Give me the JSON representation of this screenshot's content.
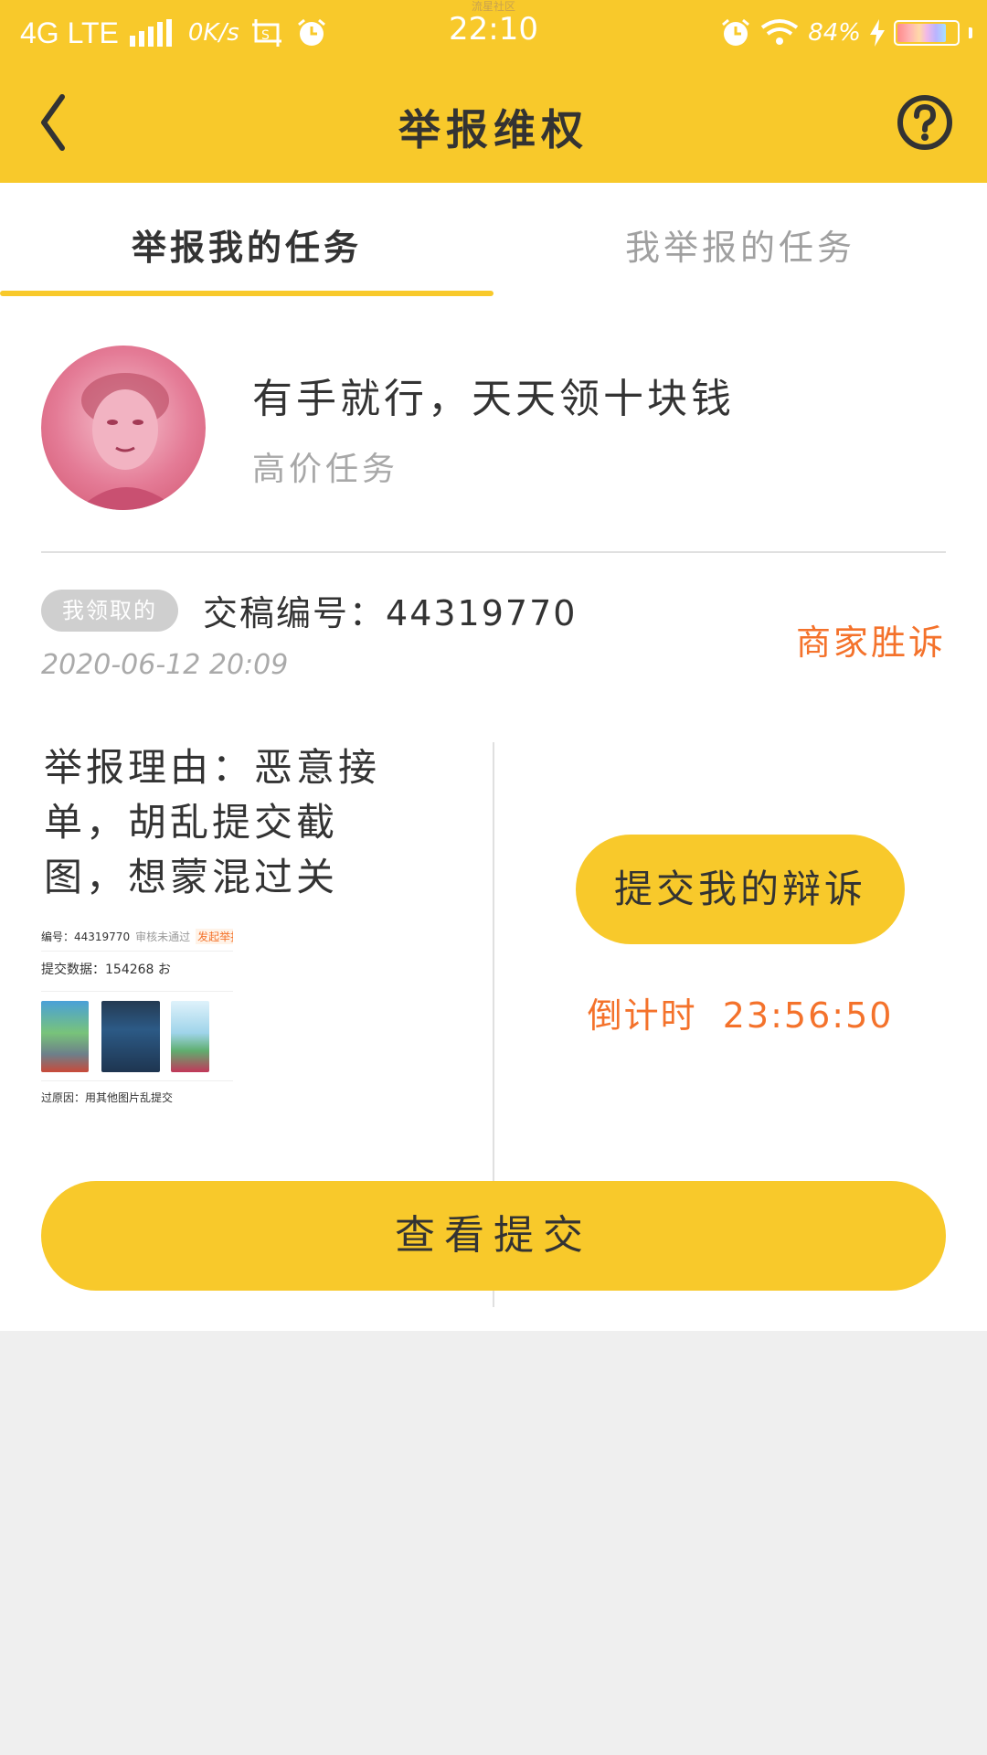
{
  "status_bar": {
    "network": "4G LTE",
    "speed": "0K/s",
    "carrier_sub": "流星社区",
    "time": "22:10",
    "battery": "84%",
    "battery_level": 0.84
  },
  "header": {
    "title": "举报维权",
    "back_icon": "chevron-left-icon",
    "help_icon": "question-circle-icon"
  },
  "tabs": [
    {
      "label": "举报我的任务",
      "active": true
    },
    {
      "label": "我举报的任务",
      "active": false
    }
  ],
  "task": {
    "title": "有手就行，天天领十块钱",
    "subtitle": "高价任务"
  },
  "record": {
    "badge": "我领取的",
    "submission_label": "交稿编号：",
    "submission_no": "44319770",
    "timestamp": "2020-06-12  20:09",
    "status": "商家胜诉",
    "reason_label": "举报理由：",
    "reason_text": "恶意接单，胡乱提交截图，想蒙混过关"
  },
  "thumbnail": {
    "row1_label": "编号：44319770",
    "row1_status": "审核未通过",
    "row1_tag": "发起举报",
    "row2": "提交数据：154268 お",
    "row3": "过原因：用其他图片乱提交"
  },
  "actions": {
    "appeal": "提交我的辩诉",
    "countdown_label": "倒计时",
    "countdown_value": "23:56:50",
    "view_submission": "查看提交"
  },
  "colors": {
    "accent": "#f8c92b",
    "status_orange": "#f4722b"
  }
}
